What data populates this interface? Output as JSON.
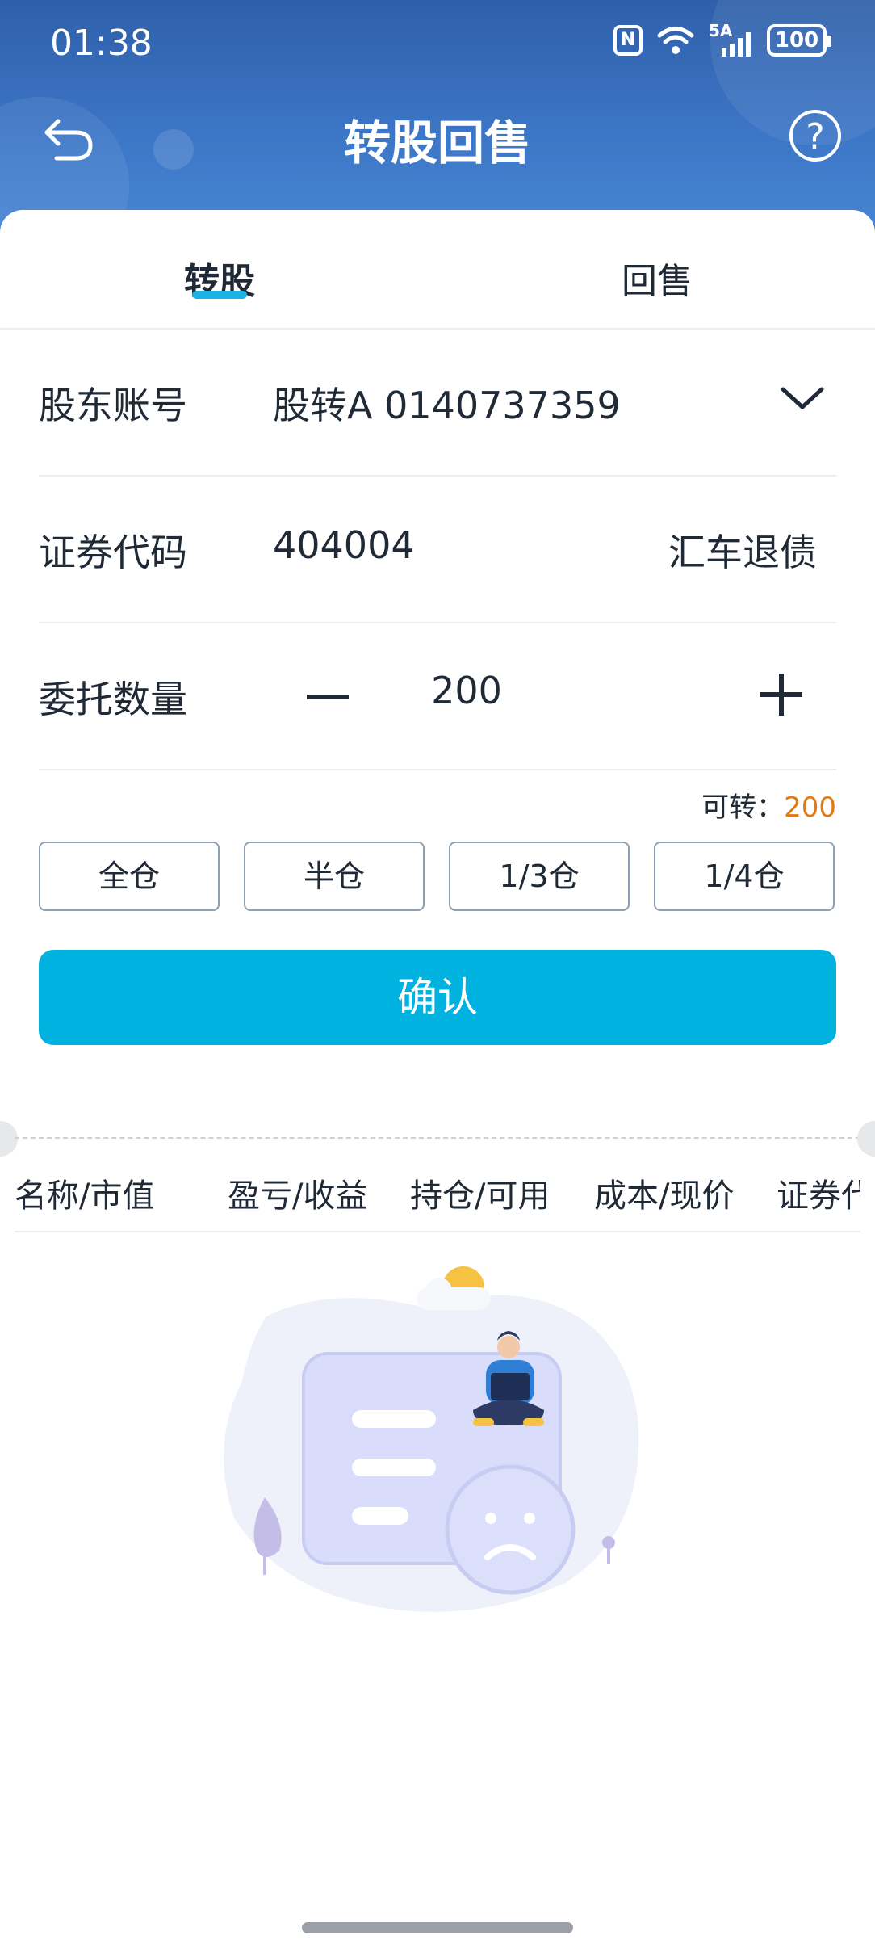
{
  "status_bar": {
    "time": "01:38",
    "nfc": "N",
    "signal_label": "5A",
    "battery": "100"
  },
  "header": {
    "title": "转股回售",
    "help": "?"
  },
  "tabs": [
    {
      "label": "转股",
      "active": true
    },
    {
      "label": "回售",
      "active": false
    }
  ],
  "form": {
    "account": {
      "label": "股东账号",
      "value": "股转A 0140737359"
    },
    "code": {
      "label": "证券代码",
      "value": "404004",
      "name": "汇车退债"
    },
    "quantity": {
      "label": "委托数量",
      "value": "200"
    },
    "available": {
      "label": "可转：",
      "value": "200"
    }
  },
  "quick_buttons": [
    "全仓",
    "半仓",
    "1/3仓",
    "1/4仓"
  ],
  "confirm_label": "确认",
  "table_headers": [
    "名称/市值",
    "盈亏/收益",
    "持仓/可用",
    "成本/现价",
    "证券代"
  ],
  "colors": {
    "header_blue": "#3c76c6",
    "accent_cyan": "#00b2e0",
    "available_orange": "#e07a17"
  },
  "icons": {
    "back": "back-arrow-icon",
    "help": "question-circle-icon",
    "dropdown": "chevron-down-icon",
    "empty": "empty-state-illustration"
  }
}
